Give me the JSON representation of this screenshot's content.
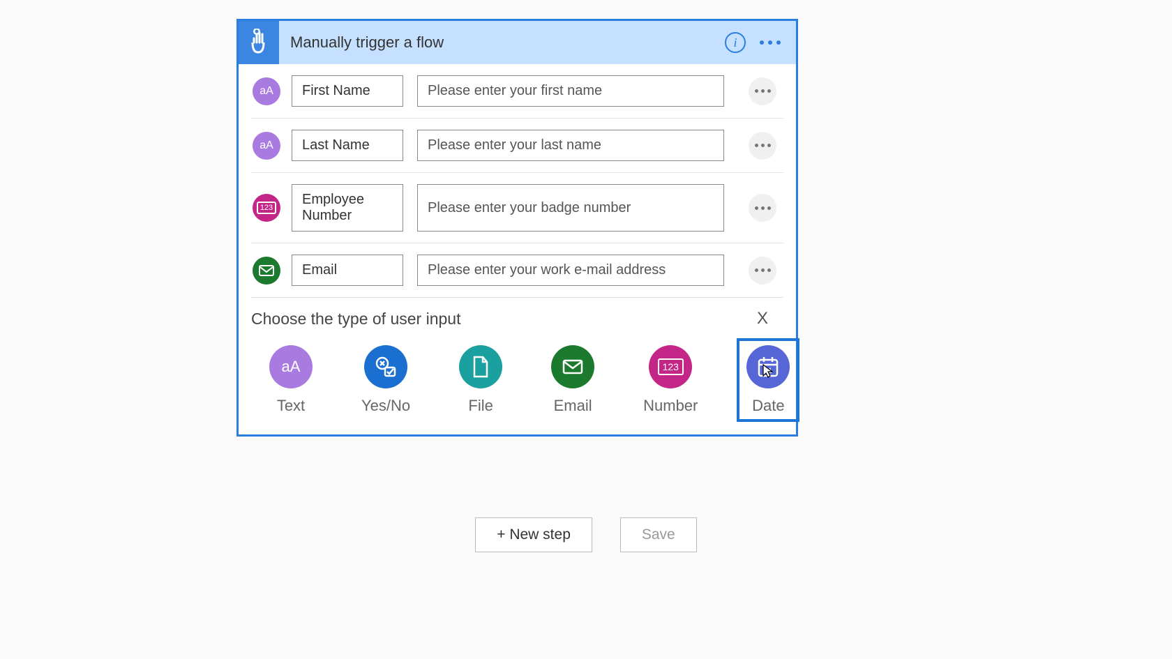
{
  "trigger": {
    "title": "Manually trigger a flow"
  },
  "inputs": [
    {
      "iconType": "text",
      "name": "First Name",
      "placeholder": "Please enter your first name"
    },
    {
      "iconType": "text",
      "name": "Last Name",
      "placeholder": "Please enter your last name"
    },
    {
      "iconType": "number",
      "name": "Employee Number",
      "placeholder": "Please enter your badge number"
    },
    {
      "iconType": "email",
      "name": "Email",
      "placeholder": "Please enter your work e-mail address"
    }
  ],
  "chooser": {
    "title": "Choose the type of user input",
    "close": "X",
    "options": [
      {
        "key": "text",
        "label": "Text"
      },
      {
        "key": "yesno",
        "label": "Yes/No"
      },
      {
        "key": "file",
        "label": "File"
      },
      {
        "key": "email",
        "label": "Email"
      },
      {
        "key": "number",
        "label": "Number"
      },
      {
        "key": "date",
        "label": "Date"
      }
    ],
    "selected": "date"
  },
  "footer": {
    "newStep": "+ New step",
    "save": "Save"
  }
}
